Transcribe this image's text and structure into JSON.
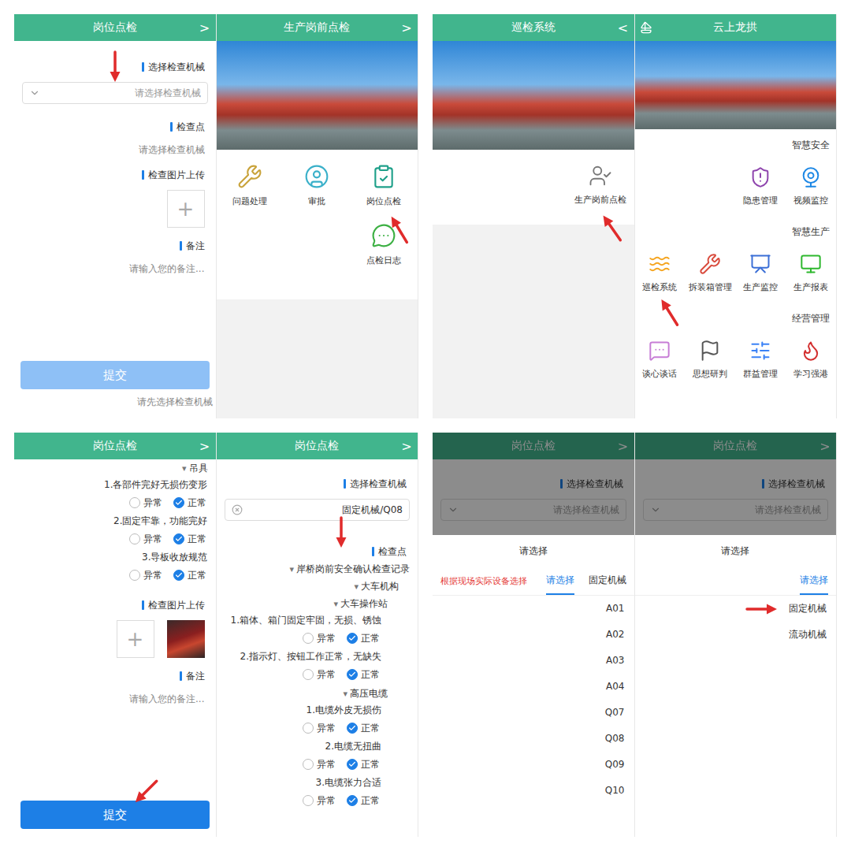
{
  "formEmpty": {
    "title": "岗位点检",
    "back": ">",
    "machine": {
      "label": "选择检查机械",
      "placeholder": "请选择检查机械",
      "arrow": true
    },
    "check": {
      "label": "检查点",
      "hint": "请选择检查机械"
    },
    "upload": {
      "label": "检查图片上传",
      "plus": "+",
      "uploaded": false
    },
    "remark": {
      "label": "备注",
      "placeholder": "请输入您的备注..."
    },
    "submit": {
      "label": "提交",
      "disabled": true,
      "arrow": false
    },
    "submitHint": "请先选择检查机械"
  },
  "preCheck": {
    "title": "生产岗前点检",
    "back": ">",
    "icons": [
      {
        "label": "岗位点检",
        "arrow": true
      },
      {
        "label": "审批",
        "arrow": false
      },
      {
        "label": "问题处理",
        "arrow": false
      },
      {
        "label": "点检日志",
        "arrow": false
      }
    ]
  },
  "patrol": {
    "title": "巡检系统",
    "back": "<",
    "icons": [
      {
        "label": "生产岗前点检",
        "arrow": true
      }
    ]
  },
  "home": {
    "title": "云上龙拱",
    "sections": [
      {
        "title": "智慧安全",
        "items": [
          {
            "label": "视频监控",
            "arrow": false
          },
          {
            "label": "隐患管理",
            "arrow": false
          }
        ]
      },
      {
        "title": "智慧生产",
        "items": [
          {
            "label": "生产报表",
            "arrow": false
          },
          {
            "label": "生产监控",
            "arrow": false
          },
          {
            "label": "拆装箱管理",
            "arrow": false
          },
          {
            "label": "巡检系统",
            "arrow": true
          }
        ]
      },
      {
        "title": "经营管理",
        "items": [
          {
            "label": "学习强港",
            "arrow": false
          },
          {
            "label": "群益管理",
            "arrow": false
          },
          {
            "label": "思想研判",
            "arrow": false
          },
          {
            "label": "谈心谈话",
            "arrow": false
          }
        ]
      }
    ]
  },
  "formScrolled": {
    "title": "岗位点检",
    "back": ">",
    "group": {
      "caret": "▾",
      "label": "吊具"
    },
    "items": [
      {
        "text": "1.各部件完好无损伤变形",
        "options": [
          {
            "label": "正常",
            "selected": true
          },
          {
            "label": "异常",
            "selected": false
          }
        ]
      },
      {
        "text": "2.固定牢靠，功能完好",
        "options": [
          {
            "label": "正常",
            "selected": true
          },
          {
            "label": "异常",
            "selected": false
          }
        ]
      },
      {
        "text": "3.导板收放规范",
        "options": [
          {
            "label": "正常",
            "selected": true
          },
          {
            "label": "异常",
            "selected": false
          }
        ]
      }
    ],
    "upload": {
      "label": "检查图片上传",
      "plus": "+",
      "uploaded": true
    },
    "remark": {
      "label": "备注",
      "placeholder": "请输入您的备注..."
    },
    "submit": {
      "label": "提交",
      "disabled": false,
      "arrow": true
    }
  },
  "formTree": {
    "title": "岗位点检",
    "back": ">",
    "machine": {
      "label": "选择检查机械",
      "value": "固定机械/Q08",
      "clear": true
    },
    "check": {
      "label": "检查点",
      "arrow": true
    },
    "tree": [
      {
        "caret": "▾",
        "label": "岸桥岗前安全确认检查记录",
        "expanded": true,
        "items": [],
        "children": [
          {
            "caret": "▾",
            "label": "大车机构",
            "expanded": true,
            "items": [],
            "children": [
              {
                "caret": "▾",
                "label": "大车操作站",
                "expanded": true,
                "children": [],
                "items": [
                  {
                    "text": "1.箱体、箱门固定牢固，无损、锈蚀",
                    "options": [
                      {
                        "label": "正常",
                        "selected": true
                      },
                      {
                        "label": "异常",
                        "selected": false
                      }
                    ]
                  },
                  {
                    "text": "2.指示灯、按钮工作正常，无缺失",
                    "options": [
                      {
                        "label": "正常",
                        "selected": true
                      },
                      {
                        "label": "异常",
                        "selected": false
                      }
                    ]
                  }
                ]
              },
              {
                "caret": "▾",
                "label": "高压电缆",
                "expanded": true,
                "children": [],
                "items": [
                  {
                    "text": "1.电缆外皮无损伤",
                    "options": [
                      {
                        "label": "正常",
                        "selected": true
                      },
                      {
                        "label": "异常",
                        "selected": false
                      }
                    ]
                  },
                  {
                    "text": "2.电缆无扭曲",
                    "options": [
                      {
                        "label": "正常",
                        "selected": true
                      },
                      {
                        "label": "异常",
                        "selected": false
                      }
                    ]
                  },
                  {
                    "text": "3.电缆张力合适",
                    "options": [
                      {
                        "label": "正常",
                        "selected": true
                      },
                      {
                        "label": "异常",
                        "selected": false
                      }
                    ]
                  }
                ]
              }
            ]
          }
        ]
      }
    ]
  },
  "pickerList": {
    "title": "岗位点检",
    "back": ">",
    "machine": {
      "label": "选择检查机械",
      "placeholder": "请选择检查机械"
    },
    "sheetTitle": "请选择",
    "tabs": [
      {
        "label": "固定机械",
        "selected": false
      },
      {
        "label": "请选择",
        "selected": true
      }
    ],
    "hint": "根据现场实际设备选择",
    "options": [
      {
        "label": "A01",
        "arrow": false
      },
      {
        "label": "A02",
        "arrow": false
      },
      {
        "label": "A03",
        "arrow": false
      },
      {
        "label": "A04",
        "arrow": false
      },
      {
        "label": "Q07",
        "arrow": false
      },
      {
        "label": "Q08",
        "arrow": false
      },
      {
        "label": "Q09",
        "arrow": false
      },
      {
        "label": "Q10",
        "arrow": false
      }
    ]
  },
  "pickerType": {
    "title": "岗位点检",
    "back": ">",
    "machine": {
      "label": "选择检查机械",
      "placeholder": "请选择检查机械"
    },
    "sheetTitle": "请选择",
    "tabs": [
      {
        "label": "请选择",
        "selected": true
      }
    ],
    "hint": "",
    "options": [
      {
        "label": "固定机械",
        "arrow": true
      },
      {
        "label": "流动机械",
        "arrow": false
      }
    ]
  }
}
